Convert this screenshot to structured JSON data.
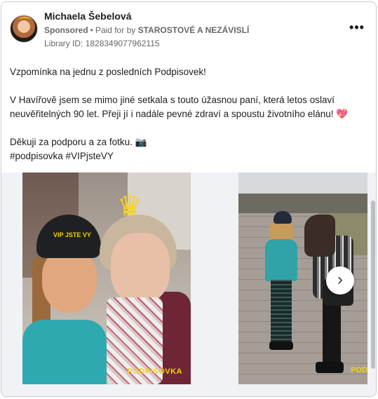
{
  "post": {
    "author": "Michaela Šebelová",
    "sponsored_label": "Sponsored",
    "paid_for_prefix": "Paid for by",
    "payer": "STAROSTOVÉ A NEZÁVISLÍ",
    "library_id": "Library ID: 1828349077962115",
    "more_label": "•••",
    "paragraphs": [
      "Vzpomínka na jednu z posledních Podpisovek!",
      "V Havířově jsem se mimo jiné setkala s touto úžasnou paní, která letos oslaví neuvěřitelných 90 let. Přeji jí i nadále pevné zdraví a spoustu životního elánu!",
      "Děkuji za podporu a za fotku.",
      "#podpisovka #VIPjsteVY"
    ],
    "heart_emoji": "💖",
    "camera_emoji": "📷"
  },
  "carousel": {
    "slide1": {
      "hat_text": "VIP JSTE VY",
      "watermark": "PODPISOVKA"
    },
    "slide2": {
      "watermark": "POD"
    },
    "next_label": "›"
  },
  "colors": {
    "accent_heart": "#e84a82",
    "brand_yellow": "#f3d500",
    "muted_text": "#65676b"
  }
}
